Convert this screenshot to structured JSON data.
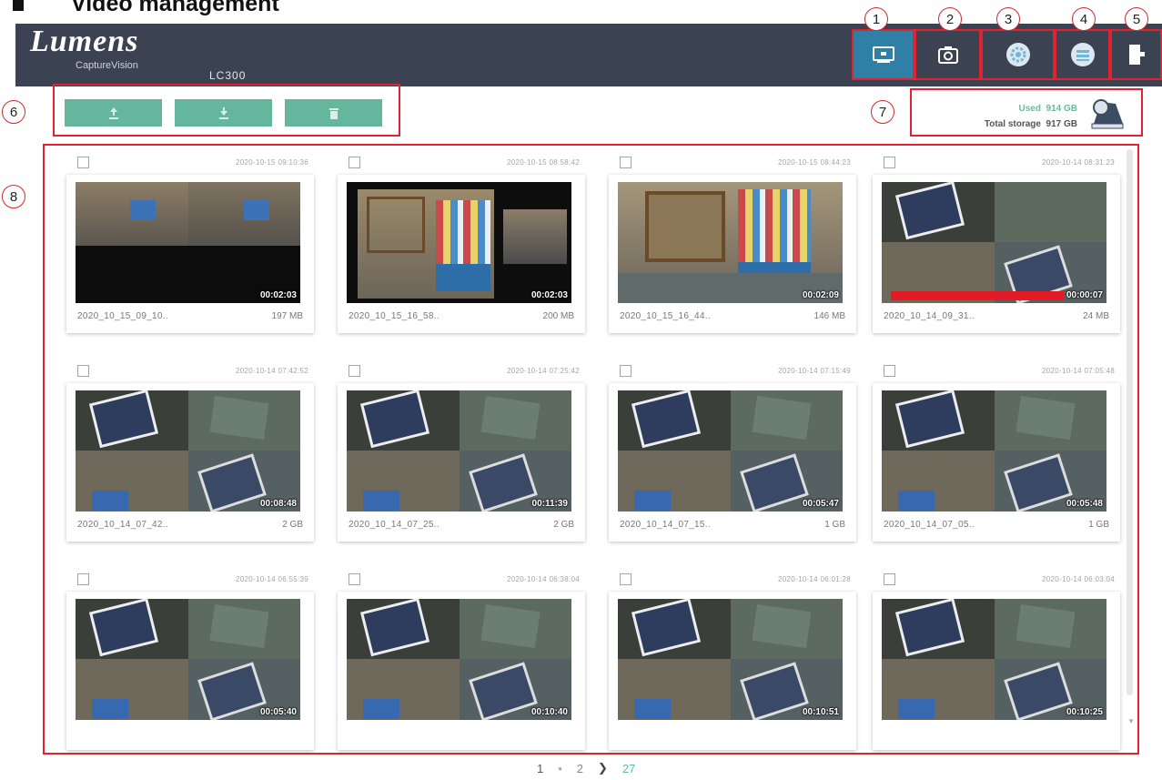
{
  "heading": "Video management",
  "app": {
    "brand": "Lumens",
    "subbrand": "CaptureVision",
    "model": "LC300"
  },
  "nav": [
    {
      "callout": "1",
      "icon": "screen-icon"
    },
    {
      "callout": "2",
      "icon": "camera-icon"
    },
    {
      "callout": "3",
      "icon": "gear-icon"
    },
    {
      "callout": "4",
      "icon": "network-icon"
    },
    {
      "callout": "5",
      "icon": "logout-icon"
    }
  ],
  "callouts": {
    "toolbar": "6",
    "storage": "7",
    "grid": "8"
  },
  "toolbar": {
    "buttons": [
      {
        "icon": "upload-icon"
      },
      {
        "icon": "download-icon"
      },
      {
        "icon": "trash-icon"
      }
    ]
  },
  "storage": {
    "used_label": "Used",
    "used": "914 GB",
    "total_label": "Total storage",
    "total": "917 GB"
  },
  "videos": [
    {
      "timestamp": "2020-10-15   09:10:36",
      "filename": "2020_10_15_09_10..",
      "size": "197 MB",
      "duration": "00:02:03",
      "style": "dark-split"
    },
    {
      "timestamp": "2020-10-15   08:58:42",
      "filename": "2020_10_15_16_58..",
      "size": "200 MB",
      "duration": "00:02:03",
      "style": "shelf-framed"
    },
    {
      "timestamp": "2020-10-15   08:44:23",
      "filename": "2020_10_15_16_44..",
      "size": "146 MB",
      "duration": "00:02:09",
      "style": "shelf"
    },
    {
      "timestamp": "2020-10-14   08:31:23",
      "filename": "2020_10_14_09_31..",
      "size": "24 MB",
      "duration": "00:00:07",
      "style": "tablets-banner"
    },
    {
      "timestamp": "2020-10-14   07:42:52",
      "filename": "2020_10_14_07_42..",
      "size": "2 GB",
      "duration": "00:08:48",
      "style": "tablets"
    },
    {
      "timestamp": "2020-10-14   07:25:42",
      "filename": "2020_10_14_07_25..",
      "size": "2 GB",
      "duration": "00:11:39",
      "style": "tablets"
    },
    {
      "timestamp": "2020-10-14   07:15:49",
      "filename": "2020_10_14_07_15..",
      "size": "1 GB",
      "duration": "00:05:47",
      "style": "tablets"
    },
    {
      "timestamp": "2020-10-14   07:05:48",
      "filename": "2020_10_14_07_05..",
      "size": "1 GB",
      "duration": "00:05:48",
      "style": "tablets"
    },
    {
      "timestamp": "2020-10-14   06:55:39",
      "filename": "",
      "size": "",
      "duration": "00:05:40",
      "style": "tablets"
    },
    {
      "timestamp": "2020-10-14   06:38:04",
      "filename": "",
      "size": "",
      "duration": "00:10:40",
      "style": "tablets"
    },
    {
      "timestamp": "2020-10-14   06:01:28",
      "filename": "",
      "size": "",
      "duration": "00:10:51",
      "style": "tablets"
    },
    {
      "timestamp": "2020-10-14   06:03:04",
      "filename": "",
      "size": "",
      "duration": "00:10:25",
      "style": "tablets"
    }
  ],
  "pagination": {
    "current": "1",
    "sep": "•",
    "next_page": "2",
    "next_icon": "chevron-right-icon",
    "last": "27"
  },
  "colors": {
    "header_bg": "#3b4252",
    "active_nav": "#2f7fa6",
    "accent_green": "#64b79c",
    "highlight_red": "#e0232e"
  }
}
